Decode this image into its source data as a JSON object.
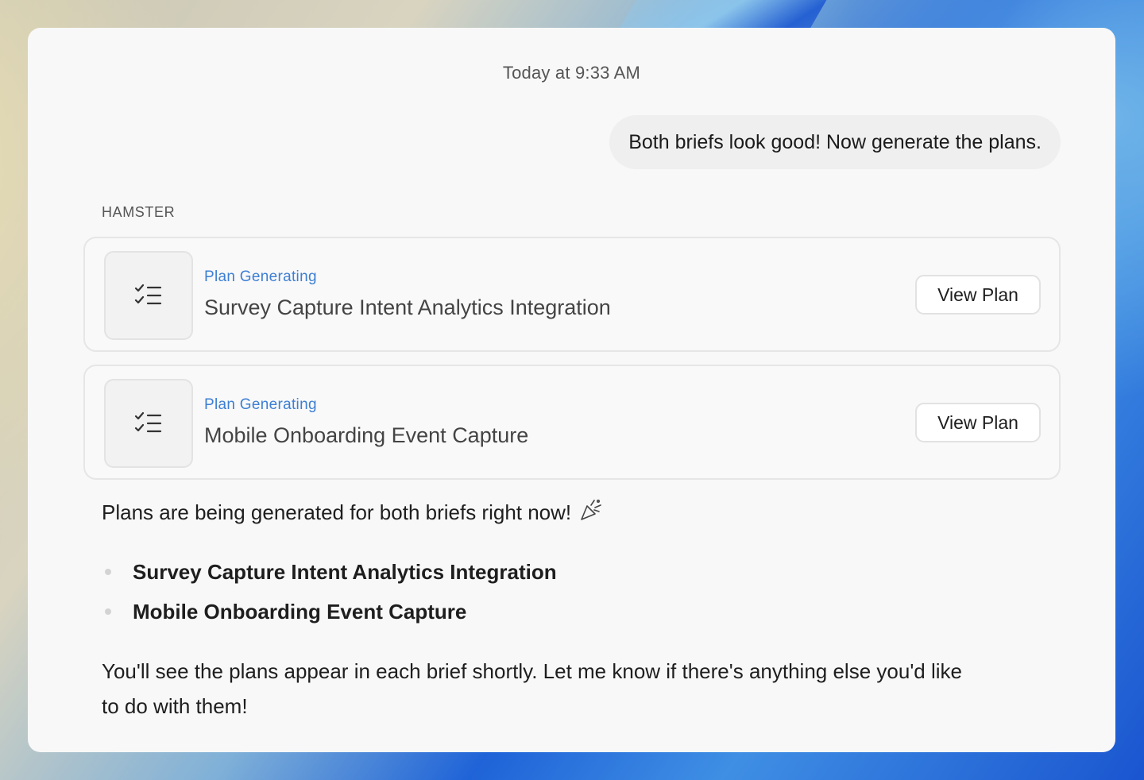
{
  "conversation": {
    "timestamp": "Today at 9:33 AM",
    "user_message": "Both briefs look good! Now generate the plans.",
    "assistant_name": "HAMSTER"
  },
  "plan_cards": [
    {
      "status": "Plan Generating",
      "title": "Survey Capture Intent Analytics Integration",
      "button_label": "View Plan",
      "icon": "checklist-icon"
    },
    {
      "status": "Plan Generating",
      "title": "Mobile Onboarding Event Capture",
      "button_label": "View Plan",
      "icon": "checklist-icon"
    }
  ],
  "reply": {
    "intro": "Plans are being generated for both briefs right now!",
    "intro_icon": "party-popper-icon",
    "items": [
      "Survey Capture Intent Analytics Integration",
      "Mobile Onboarding Event Capture"
    ],
    "closing": "You'll see the plans appear in each brief shortly. Let me know if there's anything else you'd like to do with them!"
  },
  "colors": {
    "status_accent": "#3d7fd4",
    "panel_bg": "#f8f8f8",
    "bubble_bg": "#efefef"
  }
}
